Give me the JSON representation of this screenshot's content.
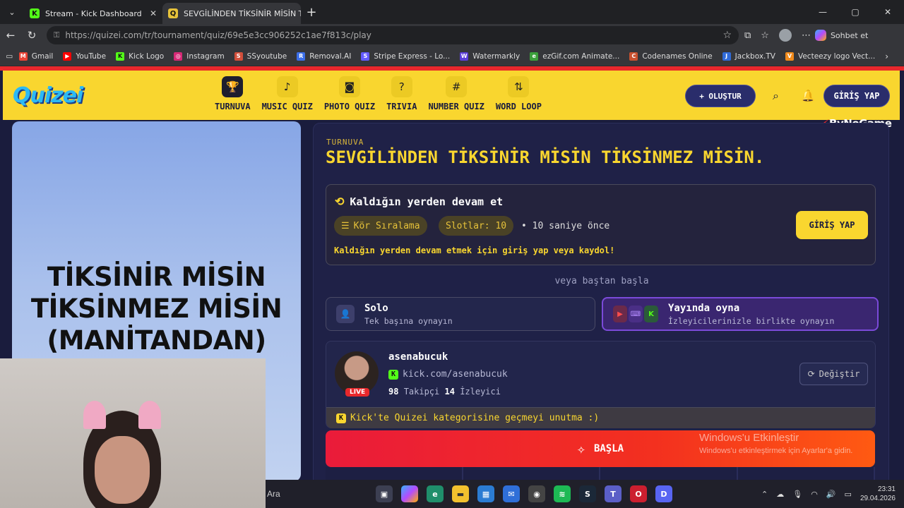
{
  "browser": {
    "tabs": [
      {
        "title": "Stream - Kick Dashboard"
      },
      {
        "title": "SEVGİLİNDEN TİKSİNİR MİSİN TİKS"
      }
    ],
    "new_tab": "+",
    "url": "https://quizei.com/tr/tournament/quiz/69e5e3cc906252c1ae7f813c/play",
    "copilot_label": "Sohbet et",
    "bookmarks": [
      {
        "label": "Gmail",
        "color": "#ea4335",
        "glyph": "M"
      },
      {
        "label": "YouTube",
        "color": "#ff0000",
        "glyph": "▶"
      },
      {
        "label": "Kick Logo",
        "color": "#53fc18",
        "glyph": "K"
      },
      {
        "label": "Instagram",
        "color": "#d62976",
        "glyph": "◎"
      },
      {
        "label": "SSyoutube",
        "color": "#d24f3b",
        "glyph": "S"
      },
      {
        "label": "Removal.AI",
        "color": "#3b6ee8",
        "glyph": "R"
      },
      {
        "label": "Stripe Express - Lo...",
        "color": "#635bff",
        "glyph": "S"
      },
      {
        "label": "Watermarkly",
        "color": "#5b3fd8",
        "glyph": "W"
      },
      {
        "label": "ezGif.com Animate...",
        "color": "#3b9f3b",
        "glyph": "e"
      },
      {
        "label": "Codenames Online",
        "color": "#c8512f",
        "glyph": "C"
      },
      {
        "label": "Jackbox.TV",
        "color": "#2f6ad8",
        "glyph": "J"
      },
      {
        "label": "Vecteezy logo Vect...",
        "color": "#f08a1b",
        "glyph": "V"
      }
    ]
  },
  "header": {
    "logo": "Quizei",
    "nav": [
      {
        "label": "TURNUVA",
        "icon": "🏆",
        "active": true
      },
      {
        "label": "MUSIC QUIZ",
        "icon": "♪",
        "active": false
      },
      {
        "label": "PHOTO QUIZ",
        "icon": "◙",
        "active": false
      },
      {
        "label": "TRIVIA",
        "icon": "?",
        "active": false
      },
      {
        "label": "NUMBER QUIZ",
        "icon": "#",
        "active": false
      },
      {
        "label": "WORD LOOP",
        "icon": "⇅",
        "active": false
      }
    ],
    "create_label": "+ OLUŞTUR",
    "login_label": "GİRİŞ YAP",
    "sponsor": {
      "a": "By",
      "b": "NoGame"
    }
  },
  "cover": {
    "lines": [
      "TİKSİNİR MİSİN",
      "TİKSİNMEZ MİSİN",
      "(MANİTANDAN)"
    ]
  },
  "quiz": {
    "kicker": "TURNUVA",
    "title": "SEVGİLİNDEN TİKSİNİR MİSİN TİKSİNMEZ MİSİN.",
    "resume": {
      "heading": "Kaldığın yerden devam et",
      "chip_mode": "Kör Sıralama",
      "chip_slots": "Slotlar: 10",
      "since": "• 10 saniye önce",
      "message": "Kaldığın yerden devam etmek için giriş yap veya kaydol!",
      "login_label": "GİRİŞ YAP"
    },
    "or_label": "veya baştan başla",
    "modes": {
      "solo": {
        "name": "Solo",
        "sub": "Tek başına oynayın"
      },
      "live": {
        "name": "Yayında oyna",
        "sub": "İzleyicilerinizle birlikte oynayın"
      }
    },
    "streamer": {
      "name": "asenabucuk",
      "live_badge": "LIVE",
      "link": "kick.com/asenabucuk",
      "followers_count": "98",
      "followers_label": "Takipçi",
      "viewers_count": "14",
      "viewers_label": "İzleyici",
      "change_label": "Değiştir",
      "hint": "Kick'te Quizei kategorisine geçmeyi unutma :)"
    },
    "start_label": "BAŞLA"
  },
  "windows_activation": {
    "line1": "Windows'u Etkinleştir",
    "line2": "Windows'u etkinleştirmek için Ayarlar'a gidin."
  },
  "taskbar": {
    "search_label": "Ara",
    "time": "23:31",
    "date": "29.04.2026"
  }
}
